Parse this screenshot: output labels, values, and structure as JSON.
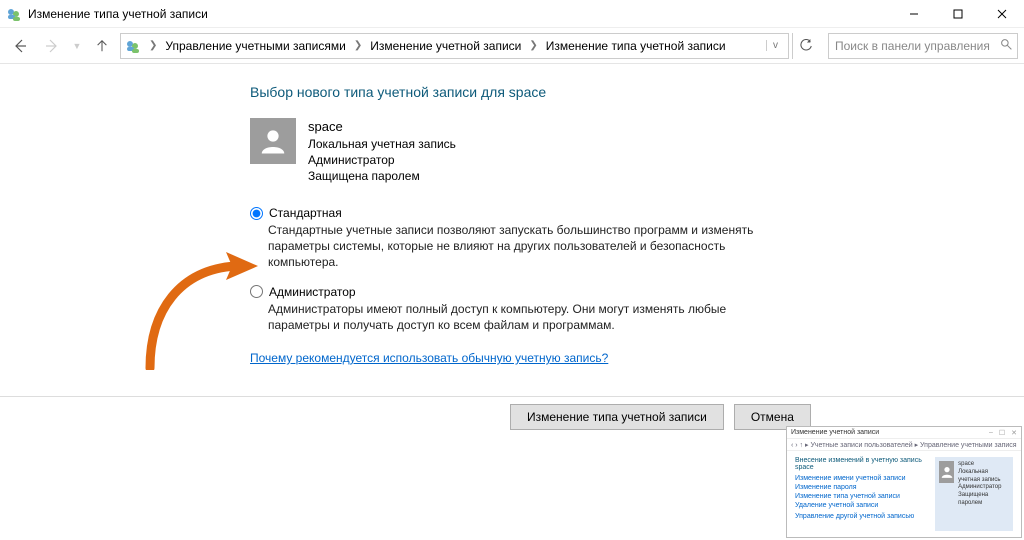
{
  "window": {
    "title": "Изменение типа учетной записи"
  },
  "nav": {
    "breadcrumb": [
      "Управление учетными записями",
      "Изменение учетной записи",
      "Изменение типа учетной записи"
    ],
    "search_placeholder": "Поиск в панели управления"
  },
  "page": {
    "heading": "Выбор нового типа учетной записи для space",
    "user": {
      "name": "space",
      "line1": "Локальная учетная запись",
      "line2": "Администратор",
      "line3": "Защищена паролем"
    },
    "options": {
      "standard": {
        "label": "Стандартная",
        "desc": "Стандартные учетные записи позволяют запускать большинство программ и изменять параметры системы, которые не влияют на других пользователей и безопасность компьютера."
      },
      "admin": {
        "label": "Администратор",
        "desc": "Администраторы имеют полный доступ к компьютеру. Они могут изменять любые параметры и получать доступ ко всем файлам и программам."
      }
    },
    "help_link": "Почему рекомендуется использовать обычную учетную запись?",
    "buttons": {
      "apply": "Изменение типа учетной записи",
      "cancel": "Отмена"
    }
  },
  "mini": {
    "title": "Изменение учетной записи",
    "breadcrumb": "‹ › ↑  ▸ Учетные записи пользователей ▸ Управление учетными записями ▸ Изменение учетной записи",
    "heading": "Внесение изменений в учетную запись space",
    "links": [
      "Изменение имени учетной записи",
      "Изменение пароля",
      "Изменение типа учетной записи",
      "Удаление учетной записи"
    ],
    "extra_link": "Управление другой учетной записью",
    "user": {
      "name": "space",
      "line1": "Локальная учетная запись",
      "line2": "Администратор",
      "line3": "Защищена паролем"
    }
  }
}
